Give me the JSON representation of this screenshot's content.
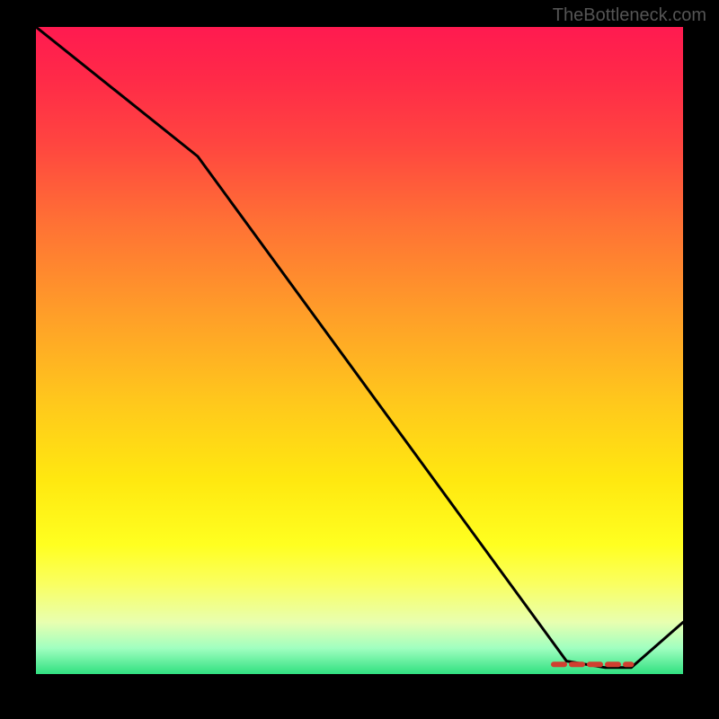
{
  "watermark": "TheBottleneck.com",
  "chart_data": {
    "type": "line",
    "title": "",
    "xlabel": "",
    "ylabel": "",
    "xlim": [
      0,
      100
    ],
    "ylim": [
      0,
      100
    ],
    "x": [
      0,
      25,
      82,
      88,
      92,
      100
    ],
    "values": [
      100,
      80,
      2,
      1,
      1,
      8
    ],
    "gradient_stops": [
      {
        "pos": 0,
        "color": "#ff1a50"
      },
      {
        "pos": 18,
        "color": "#ff4540"
      },
      {
        "pos": 45,
        "color": "#ffa028"
      },
      {
        "pos": 70,
        "color": "#ffe810"
      },
      {
        "pos": 86,
        "color": "#faff60"
      },
      {
        "pos": 96,
        "color": "#a0ffc0"
      },
      {
        "pos": 100,
        "color": "#30e080"
      }
    ],
    "markers": {
      "note": "red dashed segment near trough",
      "x_range": [
        80,
        92
      ],
      "y": 1.5
    }
  }
}
